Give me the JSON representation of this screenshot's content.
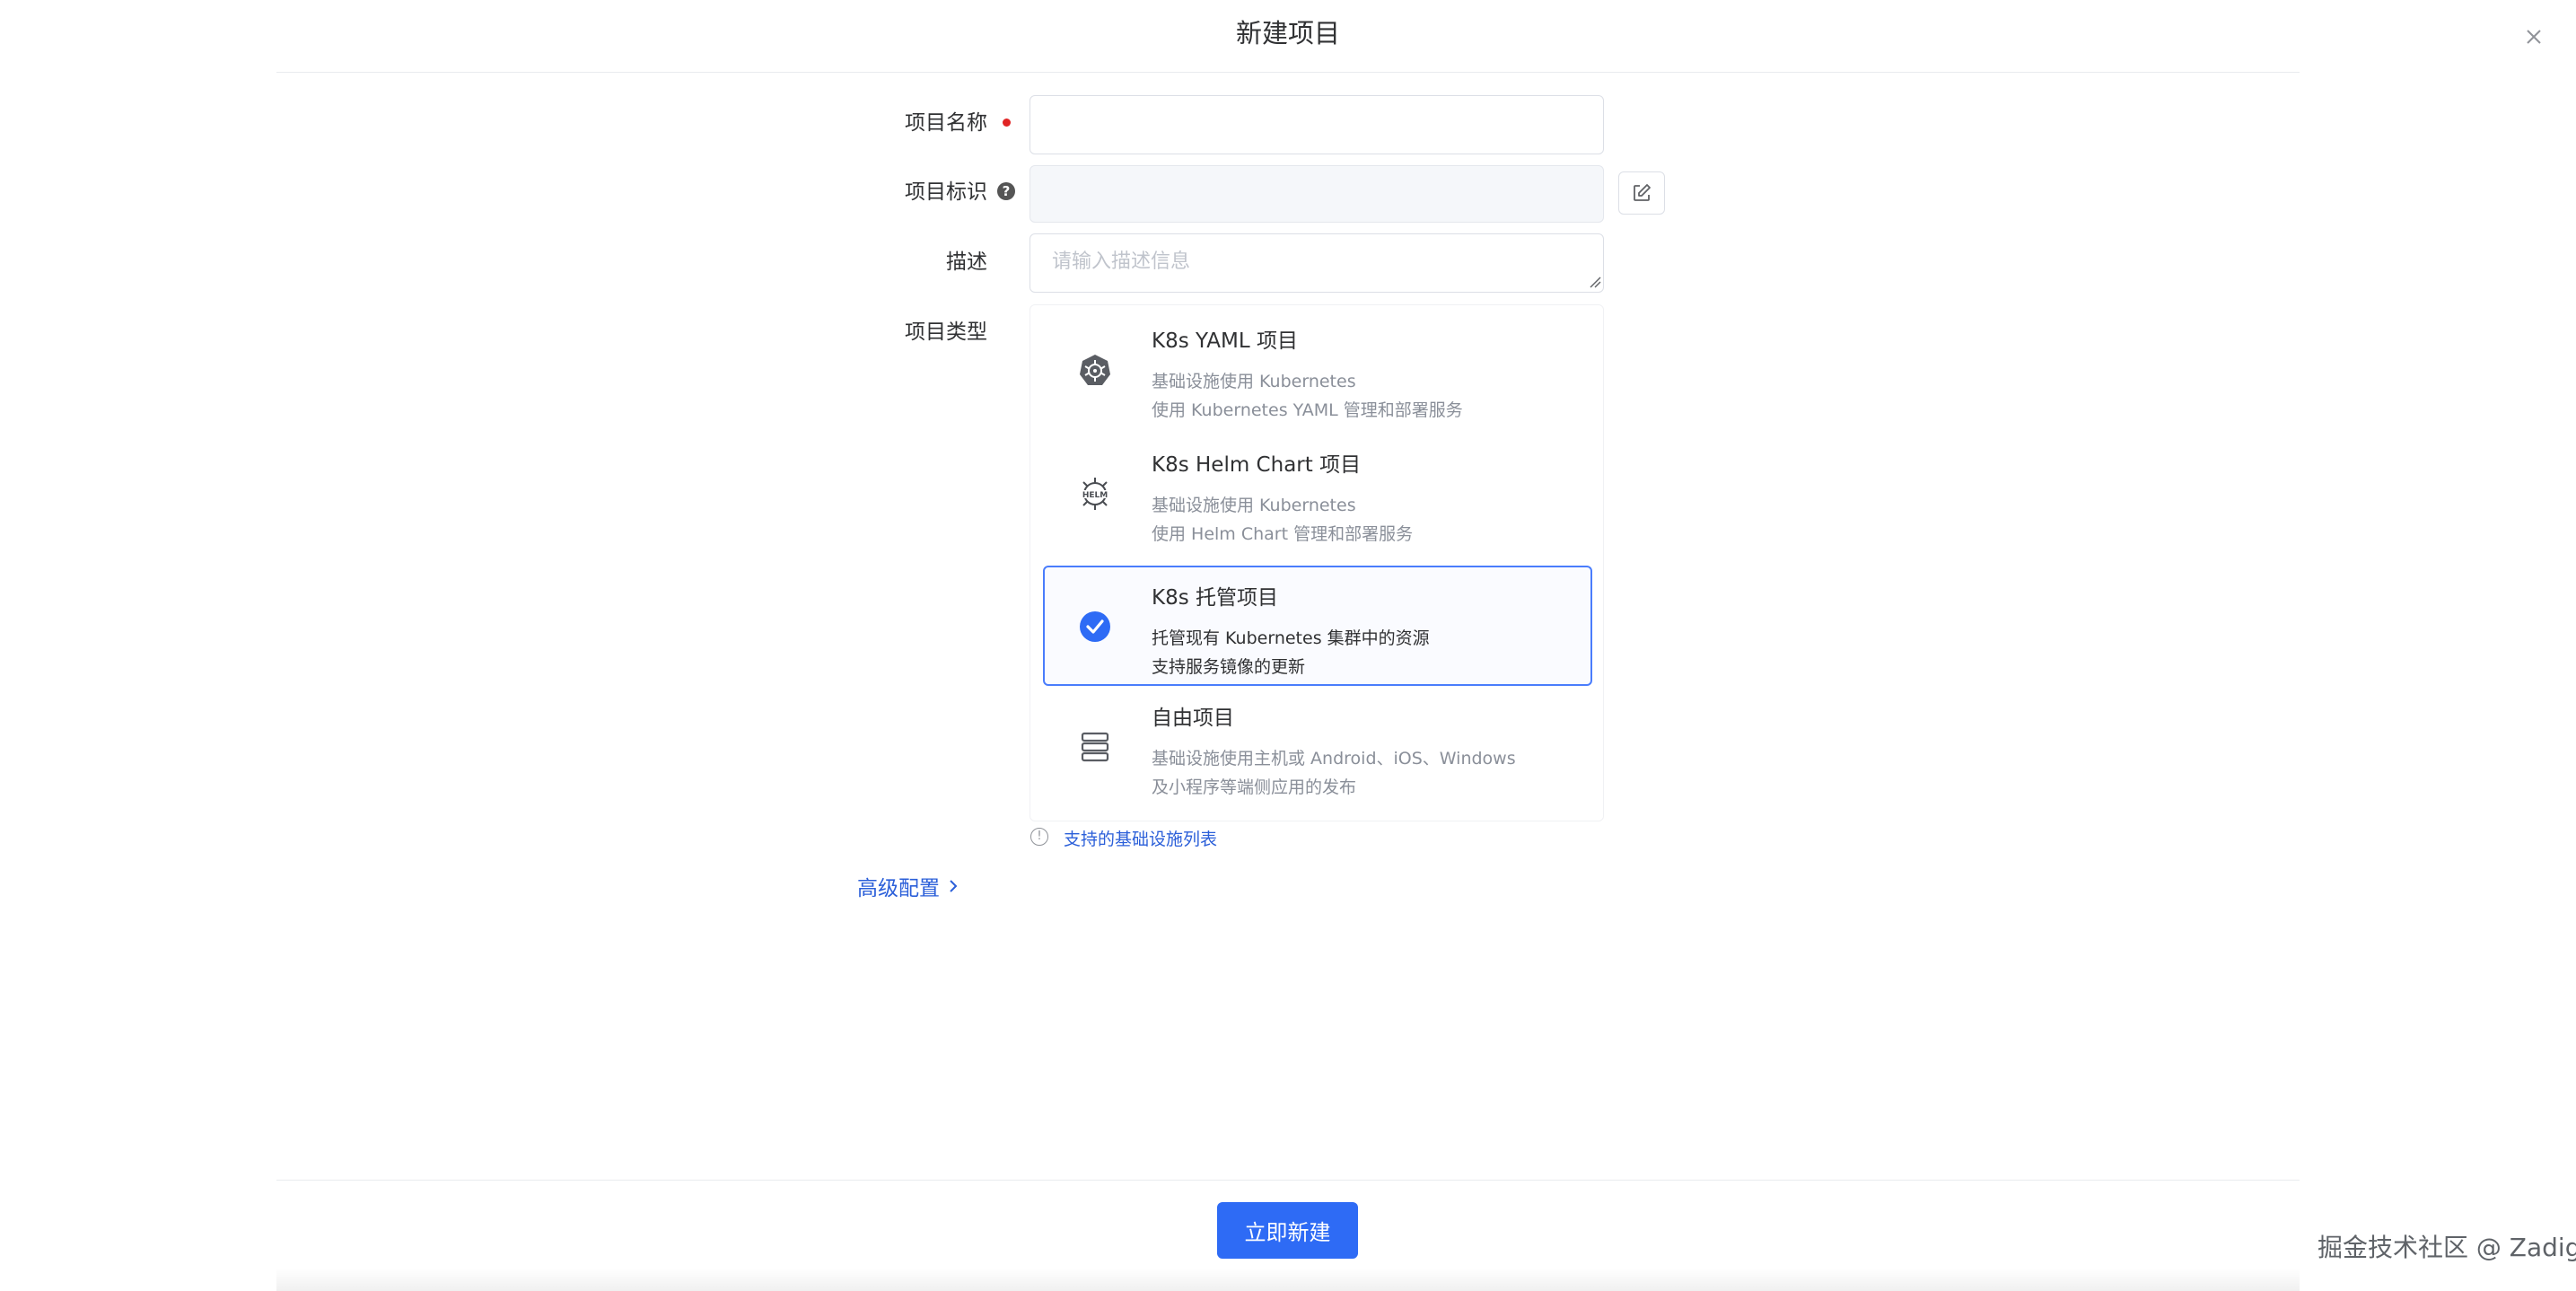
{
  "dialog": {
    "title": "新建项目"
  },
  "form": {
    "name_label": "项目名称",
    "name_value": "",
    "identifier_label": "项目标识",
    "identifier_value": "",
    "description_label": "描述",
    "description_placeholder": "请输入描述信息",
    "type_label": "项目类型"
  },
  "project_types": [
    {
      "title": "K8s YAML 项目",
      "desc1": "基础设施使用 Kubernetes",
      "desc2": "使用 Kubernetes YAML 管理和部署服务",
      "icon": "kubernetes-icon",
      "selected": false
    },
    {
      "title": "K8s Helm Chart 项目",
      "desc1": "基础设施使用 Kubernetes",
      "desc2": "使用 Helm Chart 管理和部署服务",
      "icon": "helm-icon",
      "selected": false
    },
    {
      "title": "K8s 托管项目",
      "desc1": "托管现有 Kubernetes 集群中的资源",
      "desc2": "支持服务镜像的更新",
      "icon": "check-circle-icon",
      "selected": true
    },
    {
      "title": "自由项目",
      "desc1": "基础设施使用主机或 Android、iOS、Windows",
      "desc2": "及小程序等端侧应用的发布",
      "icon": "server-icon",
      "selected": false
    }
  ],
  "links": {
    "infrastructure_list": "支持的基础设施列表",
    "advanced_settings": "高级配置"
  },
  "footer": {
    "submit_label": "立即新建"
  },
  "watermark": "掘金技术社区 @ Zadig",
  "colors": {
    "primary": "#2e6bf5",
    "link": "#2b5fd9",
    "required": "#e02424",
    "selected_border": "#4a7dfc"
  }
}
